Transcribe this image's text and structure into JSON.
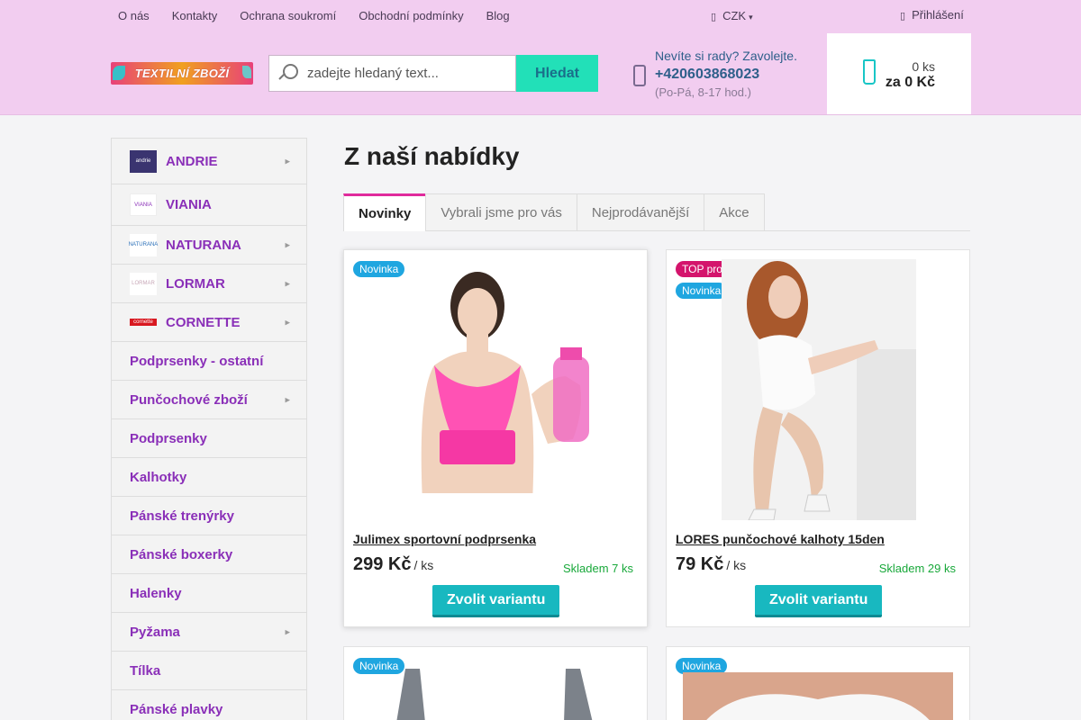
{
  "top_nav": {
    "links": [
      "O nás",
      "Kontakty",
      "Ochrana soukromí",
      "Obchodní podmínky",
      "Blog"
    ],
    "currency": "CZK",
    "login": "Přihlášení"
  },
  "logo": {
    "text": "TEXTILNÍ ZBOŽÍ"
  },
  "search": {
    "placeholder": "zadejte hledaný text...",
    "button": "Hledat"
  },
  "help": {
    "question": "Nevíte si rady? Zavolejte.",
    "phone": "+420603868023",
    "hours": "(Po-Pá, 8-17 hod.)"
  },
  "cart": {
    "count": "0 ks",
    "total": "za 0 Kč"
  },
  "sidebar": {
    "categories": [
      {
        "label": "ANDRIE",
        "has_sub": true
      },
      {
        "label": "VIANIA",
        "has_sub": false
      },
      {
        "label": "NATURANA",
        "has_sub": true
      },
      {
        "label": "LORMAR",
        "has_sub": true
      },
      {
        "label": "CORNETTE",
        "has_sub": true
      },
      {
        "label": "Podprsenky - ostatní",
        "has_sub": false
      },
      {
        "label": "Punčochové zboží",
        "has_sub": true
      },
      {
        "label": "Podprsenky",
        "has_sub": false
      },
      {
        "label": "Kalhotky",
        "has_sub": false
      },
      {
        "label": "Pánské trenýrky",
        "has_sub": false
      },
      {
        "label": "Pánské boxerky",
        "has_sub": false
      },
      {
        "label": "Halenky",
        "has_sub": false
      },
      {
        "label": "Pyžama",
        "has_sub": true
      },
      {
        "label": "Tílka",
        "has_sub": false
      },
      {
        "label": "Pánské plavky",
        "has_sub": false
      }
    ]
  },
  "main": {
    "title": "Z naší nabídky",
    "tabs": [
      "Novinky",
      "Vybrali jsme pro vás",
      "Nejprodávanější",
      "Akce"
    ],
    "active_tab": "Novinky"
  },
  "products": [
    {
      "name": "Julimex sportovní podprsenka",
      "price": "299 Kč",
      "unit": "/ ks",
      "stock": "Skladem 7 ks",
      "flags": [
        "Novinka"
      ],
      "button": "Zvolit variantu"
    },
    {
      "name": "LORES punčochové kalhoty 15den",
      "price": "79 Kč",
      "unit": "/ ks",
      "stock": "Skladem 29 ks",
      "flags": [
        "TOP produkt",
        "Novinka"
      ],
      "button": "Zvolit variantu"
    },
    {
      "flags": [
        "Novinka"
      ]
    },
    {
      "flags": [
        "Novinka"
      ]
    }
  ],
  "colors": {
    "header_bg": "#f2cdf0",
    "accent": "#8a2fb8",
    "search_button": "#22e0b8",
    "cart_button": "#18b8c0",
    "tab_active": "#e02a9c",
    "stock": "#18a83a"
  }
}
